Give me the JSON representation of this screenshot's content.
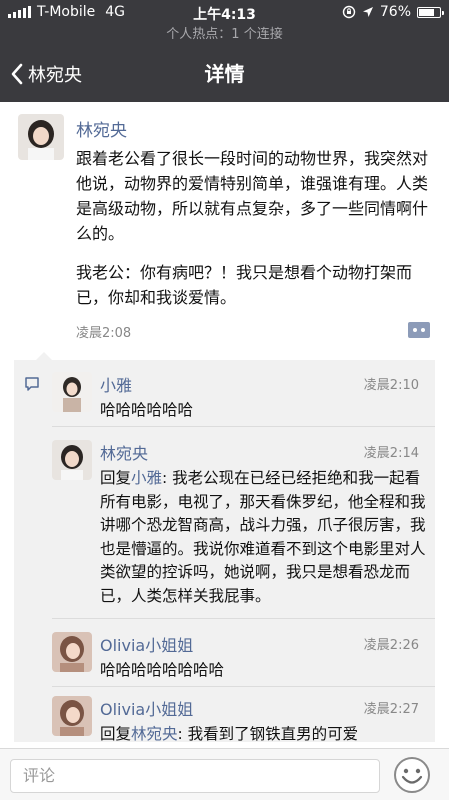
{
  "status_bar": {
    "carrier": "T-Mobile",
    "network": "4G",
    "time": "上午4:13",
    "battery": "76%",
    "battery_level": 0.76
  },
  "hotspot_text": "个人热点：1 个连接",
  "navbar": {
    "back_label": "林宛央",
    "title": "详情"
  },
  "post": {
    "author": "林宛央",
    "paragraphs": [
      "跟着老公看了很长一段时间的动物世界，我突然对他说，动物界的爱情特别简单，谁强谁有理。人类是高级动物，所以就有点复杂，多了一些同情啊什么的。",
      "我老公：你有病吧？！我只是想看个动物打架而已，你却和我谈爱情。"
    ],
    "time": "凌晨2:08"
  },
  "comments": [
    {
      "name": "小雅",
      "time": "凌晨2:10",
      "reply_prefix": "",
      "mention": "",
      "text": "哈哈哈哈哈哈"
    },
    {
      "name": "林宛央",
      "time": "凌晨2:14",
      "reply_prefix": "回复",
      "mention": "小雅",
      "text": ": 我老公现在已经已经拒绝和我一起看所有电影，电视了，那天看侏罗纪，他全程和我讲哪个恐龙智商高，战斗力强，爪子很厉害，我也是懵逼的。我说你难道看不到这个电影里对人类欲望的控诉吗，她说啊，我只是想看恐龙而已，人类怎样关我屁事。"
    },
    {
      "name": "Olivia小姐姐",
      "time": "凌晨2:26",
      "reply_prefix": "",
      "mention": "",
      "text": "哈哈哈哈哈哈哈哈"
    },
    {
      "name": "Olivia小姐姐",
      "time": "凌晨2:27",
      "reply_prefix": "回复",
      "mention": "林宛央",
      "text": ": 我看到了钢铁直男的可爱"
    }
  ],
  "comment_input": {
    "placeholder": "评论"
  },
  "colors": {
    "header_bg": "#3a3a3e",
    "link_blue": "#536a96",
    "panel_bg": "#f1f1f1"
  }
}
